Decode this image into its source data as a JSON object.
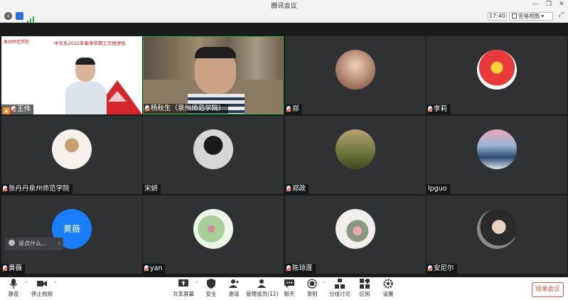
{
  "window": {
    "title": "腾讯会议",
    "controls": [
      "minimize-icon",
      "restore-icon",
      "close-icon"
    ]
  },
  "infobar": {
    "clock": "17:40",
    "view_mode": "宫格视图",
    "icons": [
      "info-icon",
      "shield-icon",
      "signal-icon",
      "fullscreen-icon"
    ]
  },
  "participants": [
    {
      "name": "王伟",
      "type": "slide",
      "slide_org": "泉州师范学院",
      "slide_title": "中文系2022年春季学期工作推进会",
      "icon": "host-icon"
    },
    {
      "name": "杨秋生（泉州师范学院）",
      "type": "camera"
    },
    {
      "name": "郑",
      "type": "avatar",
      "avatar_color": "#d9a38c"
    },
    {
      "name": "李莉",
      "type": "avatar",
      "avatar_color": "#e03a3a"
    },
    {
      "name": "张丹丹泉州师范学院",
      "type": "avatar",
      "avatar_color": "#f3efe8"
    },
    {
      "name": "宋妍",
      "type": "avatar",
      "avatar_color": "#e5e5e5"
    },
    {
      "name": "郑政",
      "type": "avatar",
      "avatar_color": "#8d8a5a"
    },
    {
      "name": "lpguo",
      "type": "avatar",
      "avatar_color": "#4e6d95"
    },
    {
      "name": "黄薇",
      "type": "text-avatar",
      "avatar_text": "黄薇",
      "avatar_color": "#1a7fff"
    },
    {
      "name": "yan",
      "type": "avatar",
      "avatar_color": "#cfe2c9"
    },
    {
      "name": "陈琼莲",
      "type": "avatar",
      "avatar_color": "#f2ecec"
    },
    {
      "name": "安尼尔",
      "type": "avatar",
      "avatar_color": "#5e5e5e"
    }
  ],
  "chat": {
    "placeholder": "说点什么..."
  },
  "toolbar": {
    "left": [
      {
        "label": "静音",
        "icon": "microphone-icon"
      },
      {
        "label": "停止视频",
        "icon": "video-camera-icon"
      }
    ],
    "center": [
      {
        "label": "共享屏幕",
        "icon": "share-screen-icon"
      },
      {
        "label": "安全",
        "icon": "shield-icon"
      },
      {
        "label": "邀请",
        "icon": "invite-icon"
      },
      {
        "label": "管理成员(12)",
        "icon": "members-icon"
      },
      {
        "label": "聊天",
        "icon": "chat-icon"
      },
      {
        "label": "录制",
        "icon": "record-icon"
      },
      {
        "label": "分组讨论",
        "icon": "breakout-icon"
      },
      {
        "label": "应用",
        "icon": "apps-icon"
      },
      {
        "label": "设置",
        "icon": "settings-icon"
      }
    ],
    "end_label": "结束会议"
  }
}
